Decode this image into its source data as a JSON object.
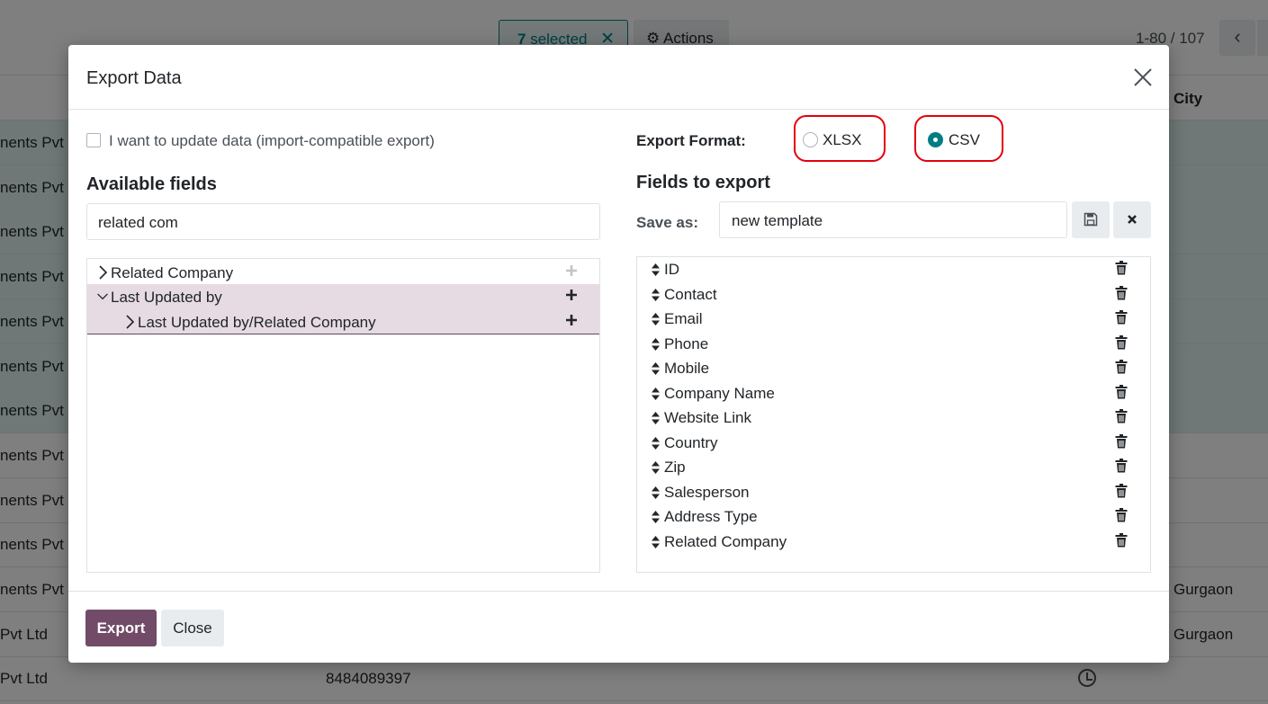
{
  "background": {
    "selected_count": "7",
    "selected_suffix": " selected",
    "actions_label": "Actions",
    "pager": "1-80 / 107",
    "city_header": "City",
    "rows": [
      {
        "col1": "nents Pvt L",
        "selected": true
      },
      {
        "col1": "nents Pvt L",
        "selected": true
      },
      {
        "col1": "nents Pvt L",
        "selected": true
      },
      {
        "col1": "nents Pvt L",
        "selected": true
      },
      {
        "col1": "nents Pvt L",
        "selected": true
      },
      {
        "col1": "nents Pvt L",
        "selected": true
      },
      {
        "col1": "nents Pvt L",
        "selected": true
      },
      {
        "col1": "nents Pvt L",
        "selected": false
      },
      {
        "col1": "nents Pvt L",
        "selected": false
      },
      {
        "col1": "nents Pvt L",
        "selected": false
      },
      {
        "col1": "nents Pvt L",
        "selected": false,
        "city": "Gurgaon"
      },
      {
        "col1": " Pvt Ltd",
        "selected": false,
        "city": "Gurgaon"
      },
      {
        "col1": " Pvt Ltd",
        "selected": false,
        "phone": "8484089397"
      }
    ]
  },
  "modal": {
    "title": "Export Data",
    "import_compatible_label": "I want to update data (import-compatible export)",
    "available_fields_heading": "Available fields",
    "search_value": "related com",
    "tree": [
      {
        "label": "Related Company",
        "expanded": false
      },
      {
        "label": "Last Updated by",
        "expanded": true
      },
      {
        "label": "Last Updated by/Related Company",
        "expanded": false
      }
    ],
    "export_format_label": "Export Format:",
    "formats": [
      {
        "label": "XLSX",
        "checked": false
      },
      {
        "label": "CSV",
        "checked": true
      }
    ],
    "fields_to_export_heading": "Fields to export",
    "save_as_label": "Save as:",
    "template_value": "new template",
    "export_fields": [
      "ID",
      "Contact",
      "Email",
      "Phone",
      "Mobile",
      "Company Name",
      "Website Link",
      "Country",
      "Zip",
      "Salesperson",
      "Address Type",
      "Related Company"
    ],
    "export_button": "Export",
    "close_button": "Close"
  },
  "colors": {
    "primary": "#714b67",
    "accent": "#017e84",
    "highlight": "#e3000f"
  },
  "icons": [
    "close-icon",
    "gear-icon",
    "chevron-left-icon",
    "chevron-right-icon",
    "chevron-down-icon",
    "plus-icon",
    "save-icon",
    "x-icon",
    "sort-icon",
    "trash-icon",
    "clock-icon"
  ]
}
